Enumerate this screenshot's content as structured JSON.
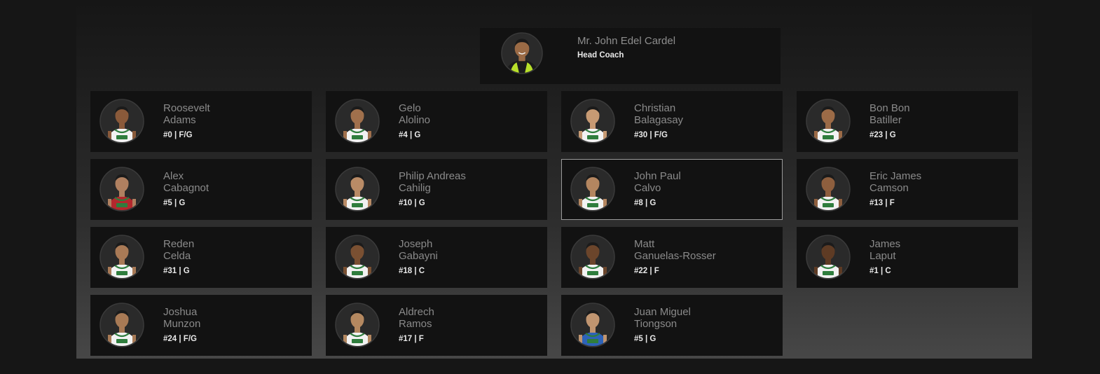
{
  "coach": {
    "name": "Mr. John Edel Cardel",
    "role": "Head Coach",
    "vest": "#b8e02a"
  },
  "players": [
    {
      "first": "Roosevelt",
      "last": "Adams",
      "meta": "#0 | F/G",
      "skin": "#8a5a3a",
      "jersey": "white"
    },
    {
      "first": "Gelo",
      "last": "Alolino",
      "meta": "#4 | G",
      "skin": "#a0704c",
      "jersey": "white"
    },
    {
      "first": "Christian",
      "last": "Balagasay",
      "meta": "#30 | F/G",
      "skin": "#c79a73",
      "jersey": "white"
    },
    {
      "first": "Bon Bon",
      "last": "Batiller",
      "meta": "#23 | G",
      "skin": "#9c6b47",
      "jersey": "white"
    },
    {
      "first": "Alex",
      "last": "Cabagnot",
      "meta": "#5 | G",
      "skin": "#b08060",
      "jersey": "red"
    },
    {
      "first": "Philip Andreas",
      "last": "Cahilig",
      "meta": "#10 | G",
      "skin": "#b98b66",
      "jersey": "white"
    },
    {
      "first": "John Paul",
      "last": "Calvo",
      "meta": "#8 | G",
      "skin": "#b48660",
      "jersey": "white"
    },
    {
      "first": "Eric James",
      "last": "Camson",
      "meta": "#13 | F",
      "skin": "#8e5f3e",
      "jersey": "white"
    },
    {
      "first": "Reden",
      "last": "Celda",
      "meta": "#31 | G",
      "skin": "#a97a56",
      "jersey": "white"
    },
    {
      "first": "Joseph",
      "last": "Gabayni",
      "meta": "#18 | C",
      "skin": "#7a5032",
      "jersey": "white"
    },
    {
      "first": "Matt",
      "last": "Ganuelas-Rosser",
      "meta": "#22 | F",
      "skin": "#6b452b",
      "jersey": "white"
    },
    {
      "first": "James",
      "last": "Laput",
      "meta": "#1 | C",
      "skin": "#5e3b24",
      "jersey": "white"
    },
    {
      "first": "Joshua",
      "last": "Munzon",
      "meta": "#24 | F/G",
      "skin": "#a87a55",
      "jersey": "white"
    },
    {
      "first": "Aldrech",
      "last": "Ramos",
      "meta": "#17 | F",
      "skin": "#b48860",
      "jersey": "white"
    },
    {
      "first": "Juan Miguel",
      "last": "Tiongson",
      "meta": "#5 | G",
      "skin": "#c09570",
      "jersey": "blue"
    }
  ],
  "hovered_player": "John Paul Calvo",
  "colors": {
    "page_background": "#161616",
    "card_background": "#121212",
    "name_text": "#8a8a8a",
    "meta_text": "#e8e8e8",
    "jersey_trim": "#2f7d3d"
  }
}
